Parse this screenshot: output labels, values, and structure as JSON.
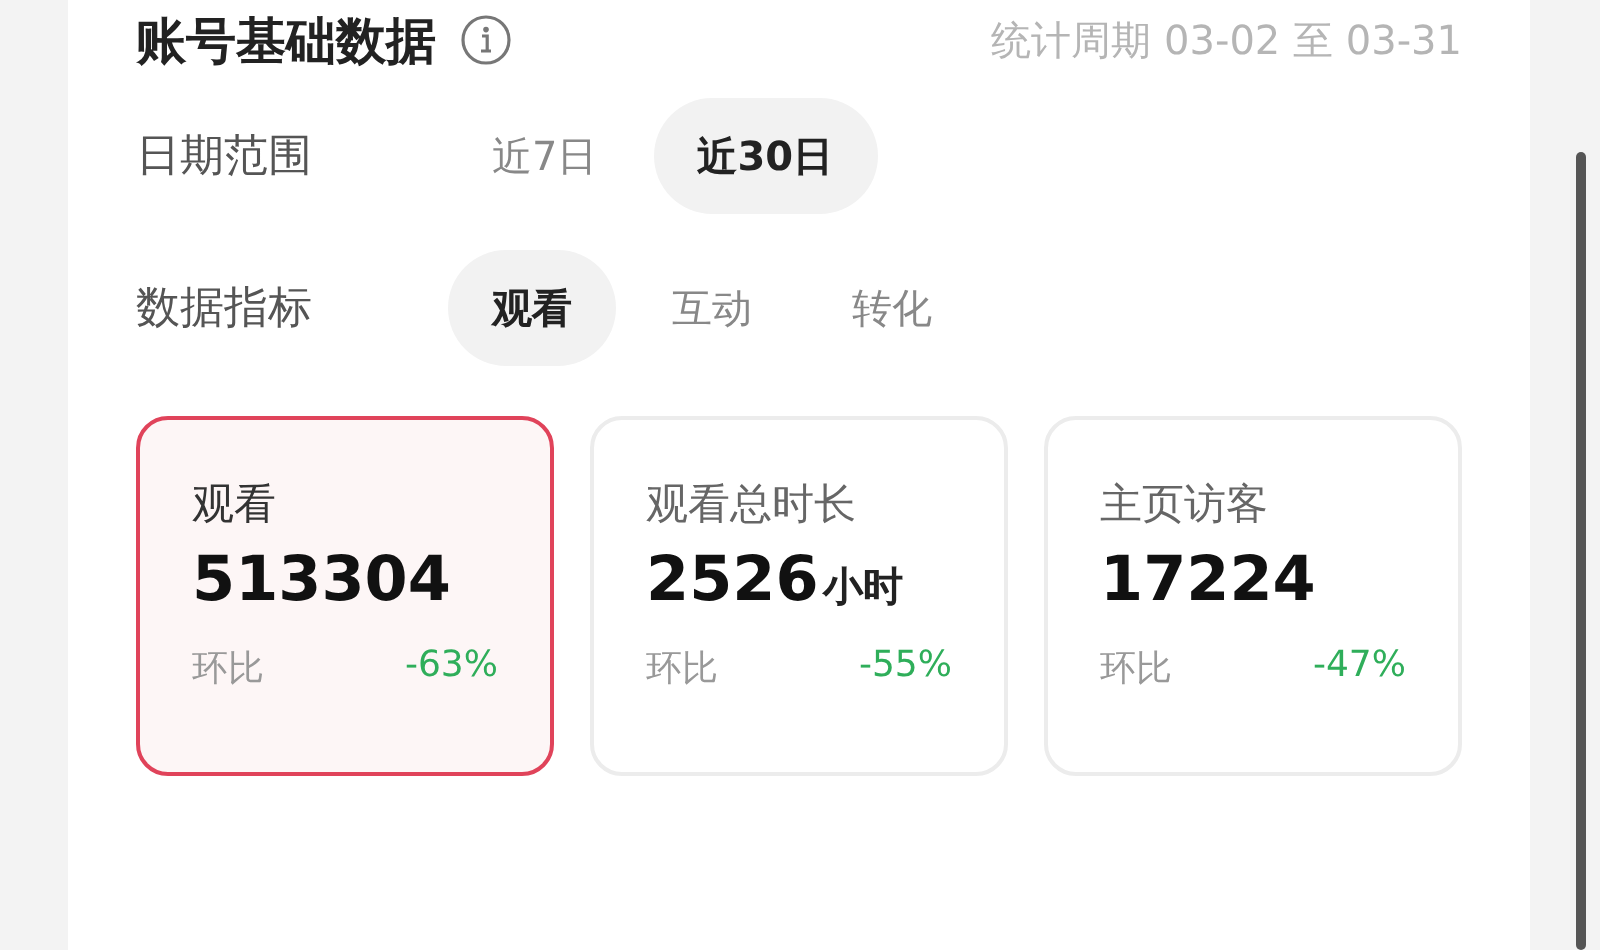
{
  "header": {
    "title": "账号基础数据",
    "period": "统计周期 03-02 至 03-31"
  },
  "filters": [
    {
      "label": "日期范围",
      "options": [
        {
          "label": "近7日",
          "selected": false
        },
        {
          "label": "近30日",
          "selected": true
        }
      ]
    },
    {
      "label": "数据指标",
      "options": [
        {
          "label": "观看",
          "selected": true
        },
        {
          "label": "互动",
          "selected": false
        },
        {
          "label": "转化",
          "selected": false
        }
      ]
    }
  ],
  "cards": [
    {
      "label": "观看",
      "value": "513304",
      "compare_label": "环比",
      "change": "-63%",
      "selected": true
    },
    {
      "label": "观看总时长",
      "value": "2526",
      "unit": "小时",
      "compare_label": "环比",
      "change": "-55%",
      "selected": false
    },
    {
      "label": "主页访客",
      "value": "17224",
      "compare_label": "环比",
      "change": "-47%",
      "selected": false
    }
  ]
}
